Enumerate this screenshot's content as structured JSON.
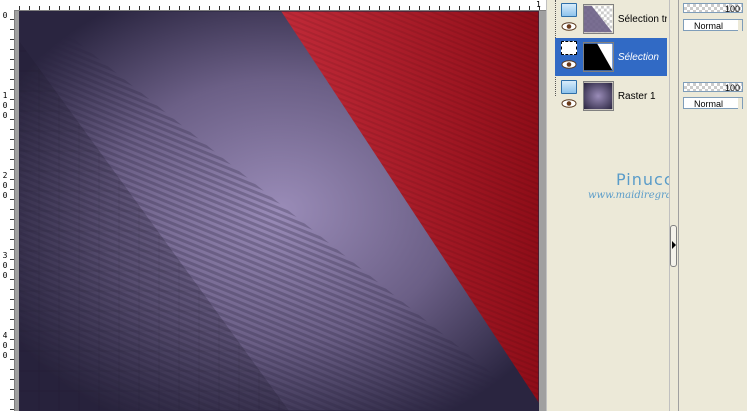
{
  "ruler": {
    "top_numbers": [
      "0",
      "1"
    ],
    "left_numbers": [
      {
        "digits": [
          "0"
        ]
      },
      {
        "digits": [
          "1",
          "0",
          "0"
        ]
      },
      {
        "digits": [
          "2",
          "0",
          "0"
        ]
      },
      {
        "digits": [
          "3",
          "0",
          "0"
        ]
      },
      {
        "digits": [
          "4",
          "0",
          "0"
        ]
      }
    ]
  },
  "layers": [
    {
      "name": "Sélection tran",
      "type": "vector",
      "selected": false,
      "thumbnail": "checker-diagonal"
    },
    {
      "name": "Sélection",
      "type": "selection",
      "selected": true,
      "thumbnail": "black-shape"
    },
    {
      "name": "Raster 1",
      "type": "raster",
      "selected": false,
      "thumbnail": "purple-gradient"
    }
  ],
  "properties": [
    {
      "opacity": "100",
      "blend": "Normal"
    },
    {
      "opacity": "100",
      "blend": "Normal"
    }
  ],
  "watermark": {
    "title": "Pinuccia",
    "url": "www.maidiregrafica.eu"
  },
  "colors": {
    "red": "#b01e2c",
    "purple_center": "#9a8cb8",
    "purple_edge": "#2a2540",
    "selected_row": "#316ac5"
  }
}
